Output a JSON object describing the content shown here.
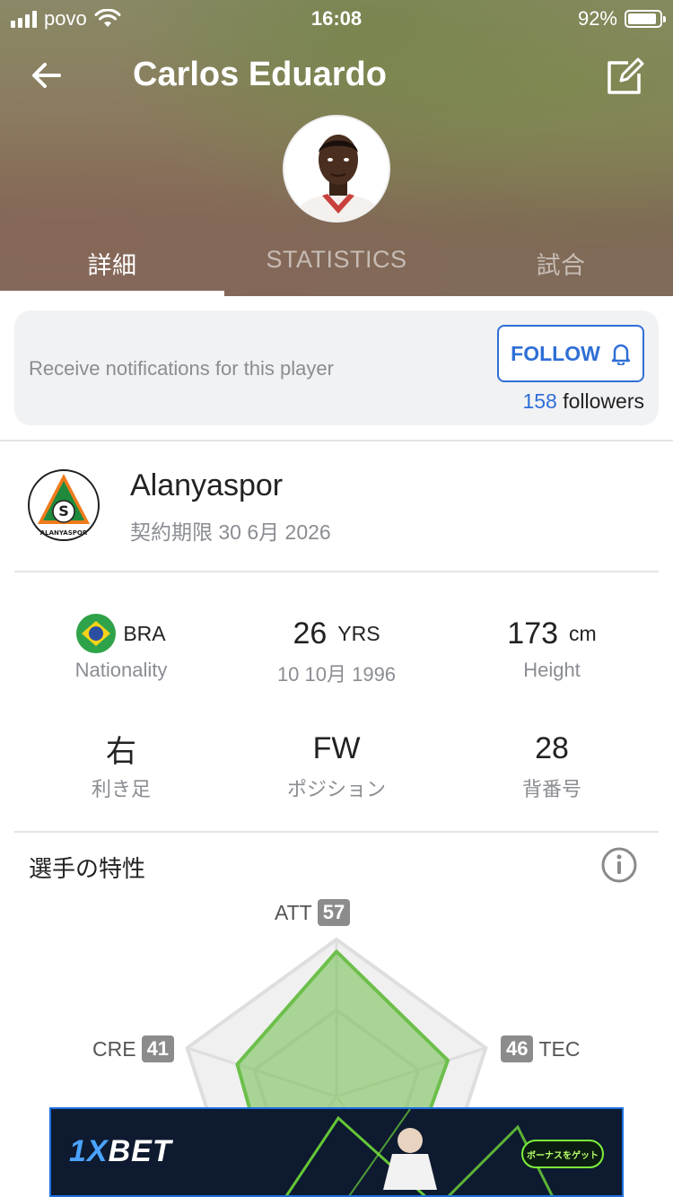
{
  "status_bar": {
    "carrier": "povo",
    "time": "16:08",
    "battery": "92%"
  },
  "header": {
    "title": "Carlos Eduardo",
    "tabs": [
      {
        "label": "詳細",
        "active": true
      },
      {
        "label": "STATISTICS",
        "active": false
      },
      {
        "label": "試合",
        "active": false
      }
    ]
  },
  "follow": {
    "prompt": "Receive notifications for this player",
    "button_label": "FOLLOW",
    "followers_count": "158",
    "followers_label": "followers"
  },
  "club": {
    "name": "Alanyaspor",
    "contract": "契約期限 30 6月 2026",
    "logo_text": "ALANYASPOR"
  },
  "details": {
    "nationality_code": "BRA",
    "nationality_label": "Nationality",
    "age": "26",
    "age_unit": "YRS",
    "birthdate": "10 10月 1996",
    "height": "173",
    "height_unit": "cm",
    "height_label": "Height",
    "foot": "右",
    "foot_label": "利き足",
    "position": "FW",
    "position_label": "ポジション",
    "number": "28",
    "number_label": "背番号"
  },
  "attributes": {
    "title": "選手の特性",
    "items": [
      {
        "label": "ATT",
        "value": 57
      },
      {
        "label": "TEC",
        "value": 46
      },
      {
        "label": "CRE",
        "value": 41
      }
    ]
  },
  "ad": {
    "brand_prefix": "1X",
    "brand_suffix": "BET",
    "cta": "ボーナスをゲット"
  },
  "colors": {
    "accent_blue": "#2f6fd6",
    "radar_green": "#6dbf4b"
  }
}
